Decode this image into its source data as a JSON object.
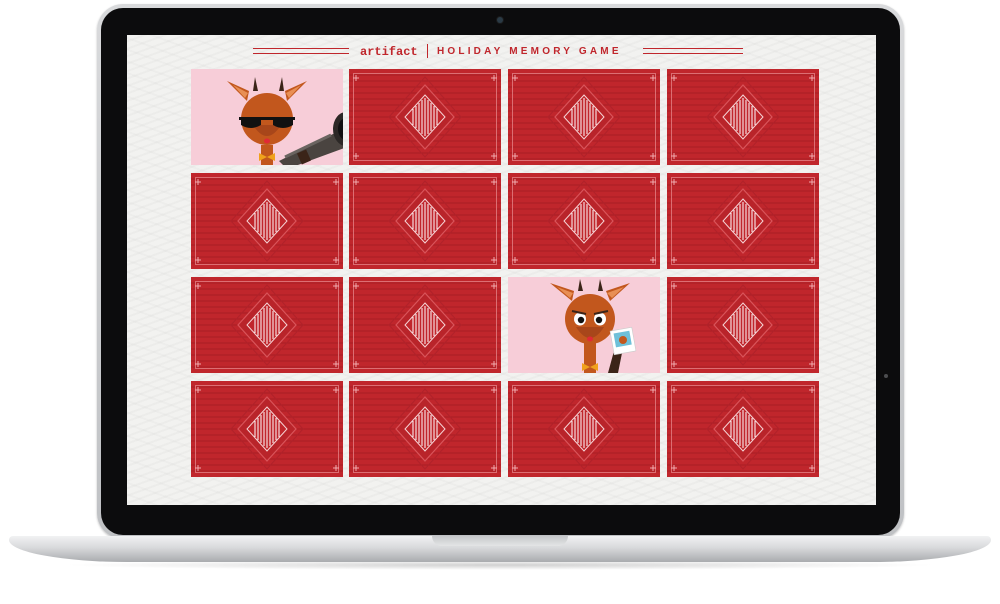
{
  "header": {
    "logo": "artifact",
    "title": "HOLIDAY MEMORY GAME"
  },
  "colors": {
    "card_back": "#c0262c",
    "card_face": "#f7cdd8",
    "accent": "#c0262c"
  },
  "cards": [
    {
      "state": "face-up",
      "image": "reindeer-with-sunglasses-and-bazooka-icon"
    },
    {
      "state": "face-down"
    },
    {
      "state": "face-down"
    },
    {
      "state": "face-down"
    },
    {
      "state": "face-down"
    },
    {
      "state": "face-down"
    },
    {
      "state": "face-down"
    },
    {
      "state": "face-down"
    },
    {
      "state": "face-down"
    },
    {
      "state": "face-down"
    },
    {
      "state": "face-up",
      "image": "reindeer-with-photo-icon"
    },
    {
      "state": "face-down"
    },
    {
      "state": "face-down"
    },
    {
      "state": "face-down"
    },
    {
      "state": "face-down"
    },
    {
      "state": "face-down"
    }
  ]
}
